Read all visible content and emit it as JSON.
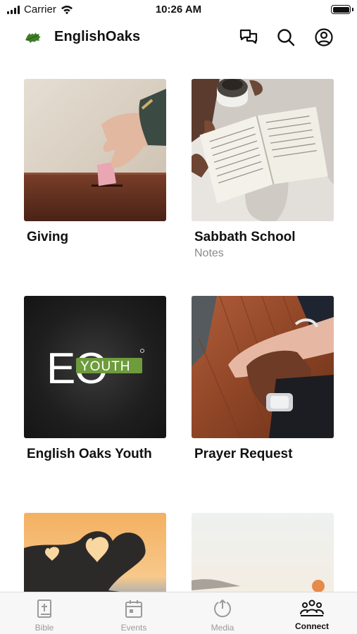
{
  "status_bar": {
    "carrier": "Carrier",
    "time": "10:26 AM"
  },
  "header": {
    "title": "EnglishOaks",
    "icons": [
      "messages-icon",
      "search-icon",
      "account-icon"
    ]
  },
  "cards": [
    {
      "title": "Giving",
      "subtitle": ""
    },
    {
      "title": "Sabbath School",
      "subtitle": "Notes"
    },
    {
      "title": "English Oaks Youth",
      "subtitle": ""
    },
    {
      "title": "Prayer Request",
      "subtitle": ""
    }
  ],
  "youth_logo": {
    "letters": "EO",
    "badge": "YOUTH"
  },
  "tabs": [
    {
      "label": "Bible",
      "icon": "bible-icon",
      "active": false
    },
    {
      "label": "Events",
      "icon": "calendar-icon",
      "active": false
    },
    {
      "label": "Media",
      "icon": "media-icon",
      "active": false
    },
    {
      "label": "Connect",
      "icon": "people-icon",
      "active": true
    }
  ],
  "colors": {
    "accent": "#111111",
    "inactive": "#9a9a9a",
    "logo_green": "#3f7d2a"
  }
}
